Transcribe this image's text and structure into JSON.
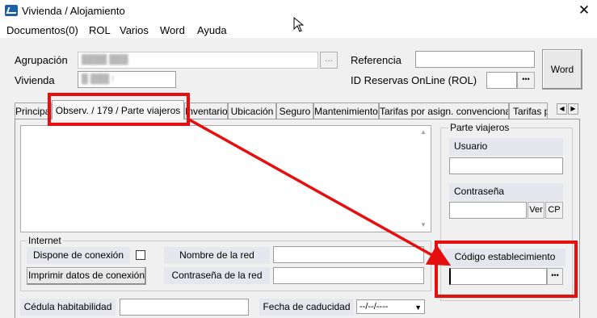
{
  "window": {
    "title": "Vivienda / Alojamiento",
    "close_glyph": "✕"
  },
  "menu": [
    {
      "label": "Documentos(0)"
    },
    {
      "label": "ROL"
    },
    {
      "label": "Varios"
    },
    {
      "label": "Word"
    },
    {
      "label": "Ayuda"
    }
  ],
  "header": {
    "agrupacion_label": "Agrupación",
    "agrupacion_value": "████ ███",
    "agrupacion_btn": "...",
    "vivienda_label": "Vivienda",
    "vivienda_value": "█ ███ I",
    "referencia_label": "Referencia",
    "referencia_value": "",
    "id_reservas_label": "ID Reservas OnLine (ROL)",
    "id_reservas_value": "",
    "id_reservas_btn": "•••",
    "word_button": "Word"
  },
  "tabs": [
    {
      "label": "Principal"
    },
    {
      "label": "Observ. / 179 / Parte viajeros",
      "active": true
    },
    {
      "label": "Inventario"
    },
    {
      "label": "Ubicación"
    },
    {
      "label": "Seguro"
    },
    {
      "label": "Mantenimiento"
    },
    {
      "label": "Tarifas por asign. convencional"
    },
    {
      "label": "Tarifas por"
    }
  ],
  "tab_scroll": {
    "left": "◀",
    "right": "▶"
  },
  "observaciones": {
    "text": ""
  },
  "parte_viajeros": {
    "legend": "Parte viajeros",
    "usuario_label": "Usuario",
    "usuario_value": "",
    "contrasena_label": "Contraseña",
    "contrasena_value": "",
    "ver_btn": "Ver",
    "cp_btn": "CP",
    "codigo_label": "Código establecimiento",
    "codigo_value": "",
    "codigo_btn": "•••"
  },
  "internet": {
    "legend": "Internet",
    "dispone_label": "Dispone de conexión",
    "dispone_checked": false,
    "imprimir_btn": "Imprimir datos de conexión",
    "red_label": "Nombre de la red",
    "red_value": "",
    "pass_label": "Contraseña de la red",
    "pass_value": ""
  },
  "footer": {
    "cedula_label": "Cédula habitabilidad",
    "cedula_value": "",
    "fecha_label": "Fecha de caducidad",
    "fecha_value": "--/--/----"
  },
  "colors": {
    "highlight": "#e50f0f"
  }
}
